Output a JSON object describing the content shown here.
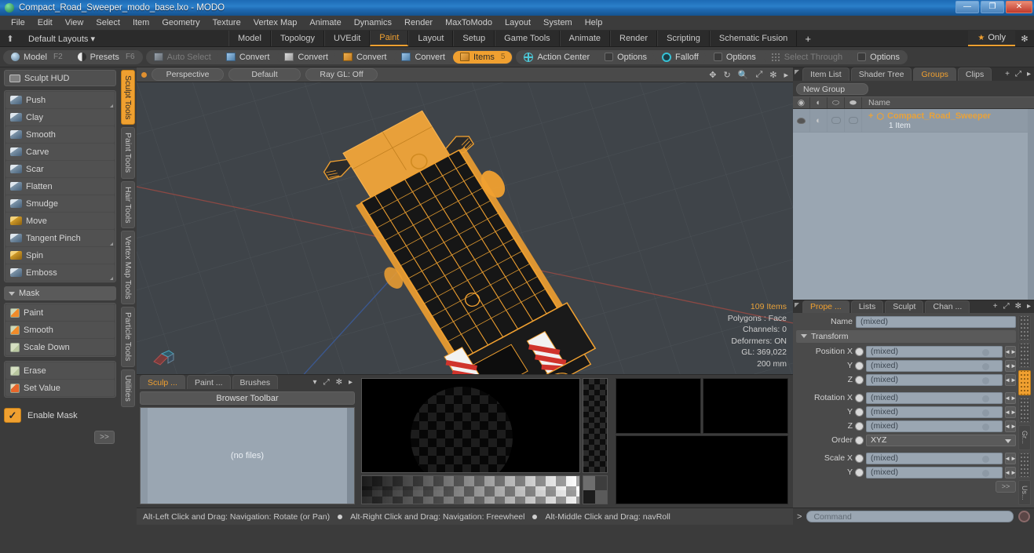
{
  "window": {
    "title": "Compact_Road_Sweeper_modo_base.lxo - MODO",
    "minimize": "—",
    "maximize": "❐",
    "close": "✕"
  },
  "menubar": {
    "items": [
      "File",
      "Edit",
      "View",
      "Select",
      "Item",
      "Geometry",
      "Texture",
      "Vertex Map",
      "Animate",
      "Dynamics",
      "Render",
      "MaxToModo",
      "Layout",
      "System",
      "Help"
    ]
  },
  "layoutbar": {
    "home_icon": "home-icon",
    "default_layouts": "Default Layouts ▾",
    "tabs": [
      {
        "label": "Model",
        "active": false
      },
      {
        "label": "Topology",
        "active": false
      },
      {
        "label": "UVEdit",
        "active": false
      },
      {
        "label": "Paint",
        "active": true
      },
      {
        "label": "Layout",
        "active": false
      },
      {
        "label": "Setup",
        "active": false
      },
      {
        "label": "Game Tools",
        "active": false
      },
      {
        "label": "Animate",
        "active": false
      },
      {
        "label": "Render",
        "active": false
      },
      {
        "label": "Scripting",
        "active": false
      },
      {
        "label": "Schematic Fusion",
        "active": false
      }
    ],
    "plus": "+",
    "only_label": "Only",
    "star": "★",
    "gear": "✻"
  },
  "modebar": {
    "left_group": [
      {
        "label": "Model",
        "hotkey": "F2",
        "icon": "sphere-icon",
        "state": "normal"
      },
      {
        "label": "Presets",
        "hotkey": "F6",
        "icon": "half-circle-icon",
        "state": "normal"
      }
    ],
    "right_group": [
      {
        "label": "Auto Select",
        "icon": "shield-icon",
        "state": "dim"
      },
      {
        "label": "Convert",
        "icon": "cube-blue-icon",
        "state": "normal"
      },
      {
        "label": "Convert",
        "icon": "cube-white-icon",
        "state": "normal"
      },
      {
        "label": "Convert",
        "icon": "cube-orange-icon",
        "state": "normal"
      },
      {
        "label": "Convert",
        "icon": "cube-blue2-icon",
        "state": "normal"
      },
      {
        "label": "Items",
        "hotkey": "5",
        "icon": "cube-icon",
        "state": "active"
      }
    ],
    "options_group": [
      {
        "label": "Action Center",
        "icon": "crosshair-icon",
        "state": "normal"
      },
      {
        "label": "Options",
        "icon": "square-icon",
        "state": "normal"
      },
      {
        "label": "Falloff",
        "icon": "circle-icon",
        "state": "normal"
      },
      {
        "label": "Options",
        "icon": "square-icon",
        "state": "normal"
      },
      {
        "label": "Select Through",
        "icon": "dots-icon",
        "state": "dim"
      },
      {
        "label": "Options",
        "icon": "square-icon",
        "state": "normal"
      }
    ]
  },
  "left_panel": {
    "sculpt_hud": {
      "label": "Sculpt HUD",
      "icon": "hud-icon"
    },
    "brushes": [
      {
        "label": "Push",
        "icon": "brush-blue-icon",
        "corner": true
      },
      {
        "label": "Clay",
        "icon": "brush-blue-icon",
        "corner": false
      },
      {
        "label": "Smooth",
        "icon": "brush-blue-icon",
        "corner": false
      },
      {
        "label": "Carve",
        "icon": "brush-blue-icon",
        "corner": false
      },
      {
        "label": "Scar",
        "icon": "brush-blue-icon",
        "corner": false
      },
      {
        "label": "Flatten",
        "icon": "brush-blue-icon",
        "corner": false
      },
      {
        "label": "Smudge",
        "icon": "brush-blue-icon",
        "corner": false
      },
      {
        "label": "Move",
        "icon": "brush-yellow-icon",
        "corner": false
      },
      {
        "label": "Tangent Pinch",
        "icon": "brush-blue-icon",
        "corner": true
      },
      {
        "label": "Spin",
        "icon": "brush-yellow-icon",
        "corner": false
      },
      {
        "label": "Emboss",
        "icon": "brush-blue-icon",
        "corner": true
      }
    ],
    "mask_header": "Mask",
    "mask_tools": [
      {
        "label": "Paint",
        "icon": "mask-orange-icon"
      },
      {
        "label": "Smooth",
        "icon": "mask-orange-icon"
      },
      {
        "label": "Scale Down",
        "icon": "mask-green-icon"
      }
    ],
    "mask_tools2": [
      {
        "label": "Erase",
        "icon": "mask-green-icon"
      },
      {
        "label": "Set Value",
        "icon": "mask-red-icon"
      }
    ],
    "enable_mask": {
      "label": "Enable Mask",
      "checked": true,
      "check": "✓"
    },
    "expand": ">>"
  },
  "left_vtabs": [
    {
      "label": "Sculpt Tools",
      "active": true
    },
    {
      "label": "Paint Tools",
      "active": false
    },
    {
      "label": "Hair Tools",
      "active": false
    },
    {
      "label": "Vertex Map Tools",
      "active": false
    },
    {
      "label": "Particle Tools",
      "active": false
    },
    {
      "label": "Utilities",
      "active": false
    }
  ],
  "viewport": {
    "header": {
      "view_mode": "Perspective",
      "shading": "Default",
      "ray_gl": "Ray GL: Off",
      "icons": [
        "pan-icon",
        "rotate-icon",
        "zoom-icon",
        "fullscreen-icon",
        "gear-icon",
        "chevron-right-icon"
      ]
    },
    "stats": {
      "items": "109 Items",
      "polygons": "Polygons : Face",
      "channels": "Channels: 0",
      "deformers": "Deformers: ON",
      "gl": "GL: 369,022",
      "scale": "200 mm"
    },
    "model": {
      "name": "Compact Road Sweeper wireframe",
      "wire_color": "#f0a030",
      "bg_color": "#3f4449",
      "axis_x_color": "#a04a4a",
      "axis_z_color": "#3a5fa8"
    }
  },
  "browser": {
    "tabs": [
      {
        "label": "Sculp ...",
        "active": true
      },
      {
        "label": "Paint ...",
        "active": false
      },
      {
        "label": "Brushes",
        "active": false
      }
    ],
    "dropdown": "▾",
    "icons": [
      "expand-icon",
      "gear-icon",
      "chevron-right-icon"
    ],
    "toolbar_label": "Browser Toolbar",
    "empty_label": "(no files)"
  },
  "right_panel": {
    "top_tabs": [
      {
        "label": "Item List",
        "active": false
      },
      {
        "label": "Shader Tree",
        "active": false
      },
      {
        "label": "Groups",
        "active": true
      },
      {
        "label": "Clips",
        "active": false
      }
    ],
    "top_plus": "+",
    "top_icons": [
      "expand-icon",
      "chevron-right-icon"
    ],
    "new_group": "New Group",
    "grid_header": {
      "col_eye": "eye-icon",
      "col_render": "render-icon",
      "col_lock": "lock-icon",
      "col_info": "info-icon",
      "name": "Name"
    },
    "rows": [
      {
        "name": "Compact_Road_Sweeper",
        "sub": "1 Item",
        "expander": "+",
        "icon": "group-icon"
      }
    ]
  },
  "properties": {
    "tabs": [
      {
        "label": "Prope ...",
        "active": true
      },
      {
        "label": "Lists",
        "active": false
      },
      {
        "label": "Sculpt",
        "active": false
      },
      {
        "label": "Chan ...",
        "active": false
      }
    ],
    "plus": "+",
    "icons": [
      "expand-icon",
      "gear-icon",
      "chevron-right-icon"
    ],
    "name_label": "Name",
    "name_value": "(mixed)",
    "transform_header": "Transform",
    "fields": [
      {
        "label": "Position X",
        "value": "(mixed)",
        "type": "number"
      },
      {
        "label": "Y",
        "value": "(mixed)",
        "type": "number"
      },
      {
        "label": "Z",
        "value": "(mixed)",
        "type": "number"
      },
      {
        "label": "Rotation X",
        "value": "(mixed)",
        "type": "number"
      },
      {
        "label": "Y",
        "value": "(mixed)",
        "type": "number"
      },
      {
        "label": "Z",
        "value": "(mixed)",
        "type": "number"
      },
      {
        "label": "Order",
        "value": "XYZ",
        "type": "select"
      },
      {
        "label": "Scale X",
        "value": "(mixed)",
        "type": "number"
      },
      {
        "label": "Y",
        "value": "(mixed)",
        "type": "number"
      }
    ],
    "expand": ">>",
    "side_tabs": [
      "",
      "",
      "",
      "",
      "Gr...",
      "",
      "Us..."
    ]
  },
  "statusbar": {
    "hint1": "Alt-Left Click and Drag: Navigation: Rotate (or Pan)",
    "hint2": "Alt-Right Click and Drag: Navigation: Freewheel",
    "hint3": "Alt-Middle Click and Drag: navRoll"
  },
  "command": {
    "arrow": ">",
    "placeholder": "Command",
    "record_icon": "record-icon"
  }
}
